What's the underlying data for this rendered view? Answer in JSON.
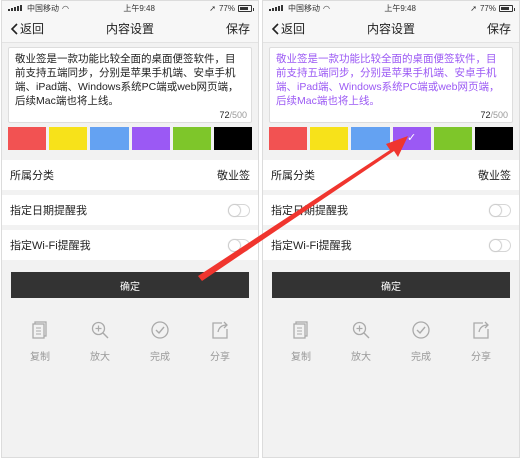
{
  "colors": {
    "swatches": [
      "#f25252",
      "#f7e21a",
      "#64a2f2",
      "#9b59f4",
      "#7ec62a",
      "#000000"
    ],
    "arrow": "#f0352e",
    "editor_text_right": "#9b59f4"
  },
  "screens": [
    {
      "status": {
        "carrier": "中国移动",
        "time": "上午9:48",
        "battery": "77%",
        "battery_level": 0.77
      },
      "nav": {
        "back": "返回",
        "title": "内容设置",
        "save": "保存"
      },
      "editor": {
        "text": "敬业签是一款功能比较全面的桌面便签软件，目前支持五端同步，分别是苹果手机端、安卓手机端、iPad端、Windows系统PC端或web网页端，后续Mac端也将上线。",
        "count": "72",
        "max": "/500"
      },
      "selected_swatch": -1,
      "category": {
        "label": "所属分类",
        "value": "敬业签"
      },
      "date_reminder": {
        "label": "指定日期提醒我",
        "on": false
      },
      "wifi_reminder": {
        "label": "指定Wi-Fi提醒我",
        "on": false
      },
      "confirm": "确定",
      "actions": [
        {
          "icon": "copy-icon",
          "label": "复制"
        },
        {
          "icon": "zoom-in-icon",
          "label": "放大"
        },
        {
          "icon": "check-circle-icon",
          "label": "完成"
        },
        {
          "icon": "share-icon",
          "label": "分享"
        }
      ]
    },
    {
      "status": {
        "carrier": "中国移动",
        "time": "上午9:48",
        "battery": "77%",
        "battery_level": 0.77
      },
      "nav": {
        "back": "返回",
        "title": "内容设置",
        "save": "保存"
      },
      "editor": {
        "text": "敬业签是一款功能比较全面的桌面便签软件，目前支持五端同步，分别是苹果手机端、安卓手机端、iPad端、Windows系统PC端或web网页端，后续Mac端也将上线。",
        "count": "72",
        "max": "/500"
      },
      "selected_swatch": 3,
      "category": {
        "label": "所属分类",
        "value": "敬业签"
      },
      "date_reminder": {
        "label": "指定日期提醒我",
        "on": false
      },
      "wifi_reminder": {
        "label": "指定Wi-Fi提醒我",
        "on": false
      },
      "confirm": "确定",
      "actions": [
        {
          "icon": "copy-icon",
          "label": "复制"
        },
        {
          "icon": "zoom-in-icon",
          "label": "放大"
        },
        {
          "icon": "check-circle-icon",
          "label": "完成"
        },
        {
          "icon": "share-icon",
          "label": "分享"
        }
      ]
    }
  ]
}
